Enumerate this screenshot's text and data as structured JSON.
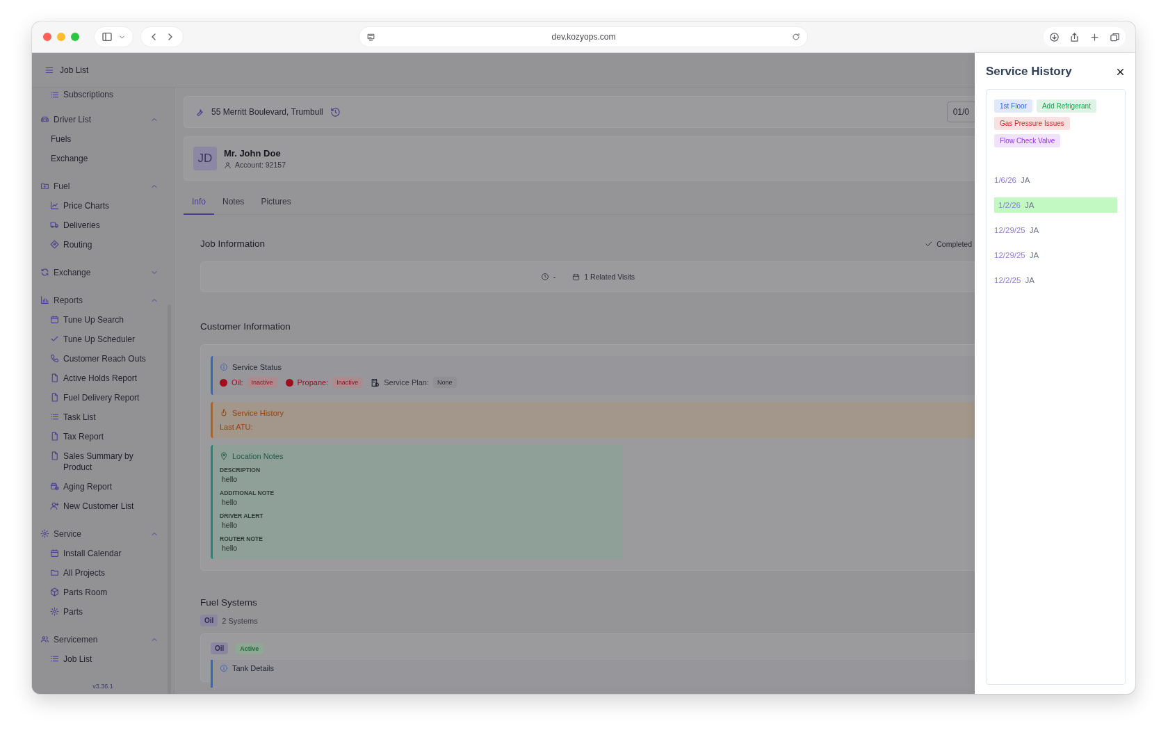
{
  "browser": {
    "url": "dev.kozyops.com"
  },
  "header": {
    "title": "Job List"
  },
  "sidebar": {
    "items": [
      {
        "label": "Subscriptions",
        "kind": "link"
      },
      {
        "label": "Driver List",
        "kind": "group",
        "expanded": true,
        "children": [
          {
            "label": "Fuels"
          },
          {
            "label": "Exchange"
          }
        ]
      },
      {
        "label": "Fuel",
        "kind": "group",
        "expanded": true,
        "children": [
          {
            "label": "Price Charts"
          },
          {
            "label": "Deliveries"
          },
          {
            "label": "Routing"
          }
        ]
      },
      {
        "label": "Exchange",
        "kind": "group",
        "expanded": false
      },
      {
        "label": "Reports",
        "kind": "group",
        "expanded": true,
        "children": [
          {
            "label": "Tune Up Search"
          },
          {
            "label": "Tune Up Scheduler"
          },
          {
            "label": "Customer Reach Outs"
          },
          {
            "label": "Active Holds Report"
          },
          {
            "label": "Fuel Delivery Report"
          },
          {
            "label": "Task List"
          },
          {
            "label": "Tax Report"
          },
          {
            "label": "Sales Summary by Product"
          },
          {
            "label": "Aging Report"
          },
          {
            "label": "New Customer List"
          }
        ]
      },
      {
        "label": "Service",
        "kind": "group",
        "expanded": true,
        "children": [
          {
            "label": "Install Calendar"
          },
          {
            "label": "All Projects"
          },
          {
            "label": "Parts Room"
          },
          {
            "label": "Parts"
          }
        ]
      },
      {
        "label": "Servicemen",
        "kind": "group",
        "expanded": true,
        "children": [
          {
            "label": "Job List"
          }
        ]
      }
    ],
    "version": "v3.36.1"
  },
  "job": {
    "address": "55 Merritt Boulevard, Trumbull",
    "date": "01/0",
    "customer": {
      "initials": "JD",
      "name": "Mr. John Doe",
      "account": "Account: 92157"
    },
    "tabs": [
      {
        "label": "Info",
        "selected": true
      },
      {
        "label": "Notes",
        "selected": false
      },
      {
        "label": "Pictures",
        "selected": false
      }
    ],
    "job_information": {
      "title": "Job Information",
      "status": "Completed",
      "time": "-",
      "related": "1 Related Visits"
    },
    "customer_information": {
      "title": "Customer Information",
      "service_status": {
        "title": "Service Status",
        "items": [
          {
            "kind": "fuel",
            "label": "Oil:",
            "value": "Inactive"
          },
          {
            "kind": "fuel",
            "label": "Propane:",
            "value": "Inactive"
          },
          {
            "kind": "plan",
            "label": "Service Plan:",
            "value": "None"
          }
        ]
      },
      "service_history": {
        "title": "Service History",
        "text": "Last ATU:"
      },
      "location_notes": {
        "title": "Location Notes",
        "fields": [
          {
            "label": "DESCRIPTION",
            "value": "hello"
          },
          {
            "label": "ADDITIONAL NOTE",
            "value": "hello"
          },
          {
            "label": "DRIVER ALERT",
            "value": "hello"
          },
          {
            "label": "ROUTER NOTE",
            "value": "hello"
          }
        ]
      }
    },
    "fuel_systems": {
      "title": "Fuel Systems",
      "filter": "Oil",
      "count": "2 Systems",
      "systems": [
        {
          "type": "Oil",
          "status": "Active",
          "section": "Tank Details"
        }
      ]
    }
  },
  "panel": {
    "title": "Service History",
    "tags": [
      {
        "label": "1st Floor",
        "color": "#2563eb"
      },
      {
        "label": "Add Refrigerant",
        "color": "#16a34a"
      },
      {
        "label": "Gas Pressure Issues",
        "color": "#dc2626"
      },
      {
        "label": "Flow Check Valve",
        "color": "#9333ea"
      }
    ],
    "history": [
      {
        "date": "1/6/26",
        "tech": "JA",
        "selected": false
      },
      {
        "date": "1/2/26",
        "tech": "JA",
        "selected": true
      },
      {
        "date": "12/29/25",
        "tech": "JA",
        "selected": false
      },
      {
        "date": "12/29/25",
        "tech": "JA",
        "selected": false
      },
      {
        "date": "12/2/25",
        "tech": "JA",
        "selected": false
      }
    ]
  }
}
